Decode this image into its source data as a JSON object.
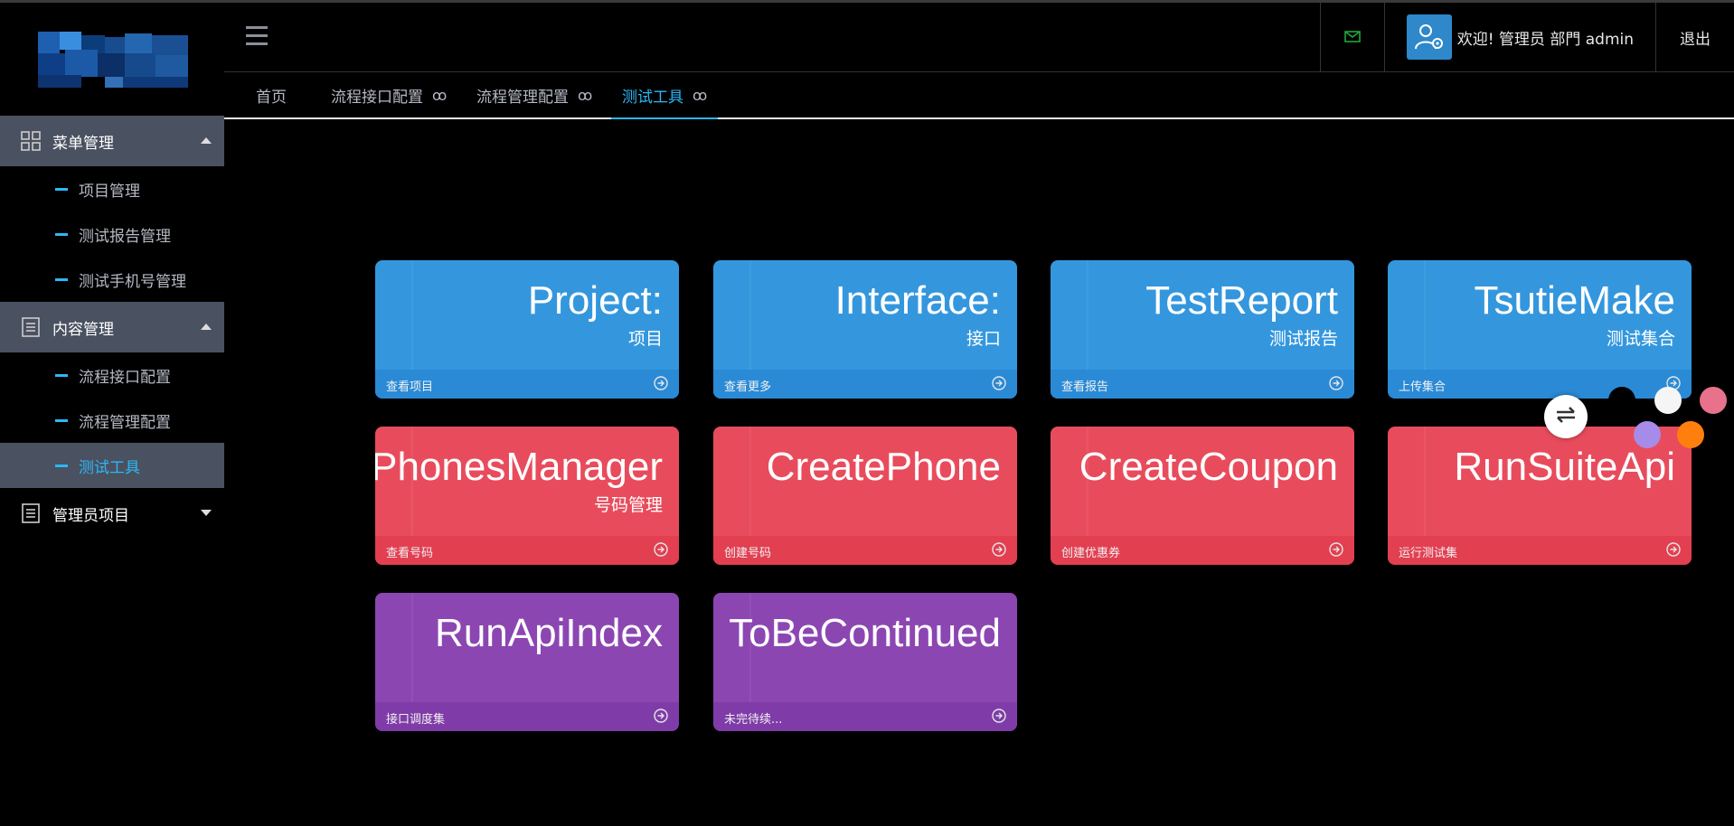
{
  "sidebar": {
    "groups": [
      {
        "label": "菜单管理",
        "items": [
          {
            "label": "项目管理"
          },
          {
            "label": "测试报告管理"
          },
          {
            "label": "测试手机号管理"
          }
        ]
      },
      {
        "label": "内容管理",
        "items": [
          {
            "label": "流程接口配置"
          },
          {
            "label": "流程管理配置"
          },
          {
            "label": "测试工具"
          }
        ]
      },
      {
        "label": "管理员项目",
        "items": []
      }
    ]
  },
  "header": {
    "welcome": "欢迎! 管理员 部門 admin",
    "logout": "退出"
  },
  "tabs": [
    {
      "label": "首页"
    },
    {
      "label": "流程接口配置",
      "close": "ꝏ"
    },
    {
      "label": "流程管理配置",
      "close": "ꝏ"
    },
    {
      "label": "测试工具",
      "close": "ꝏ"
    }
  ],
  "cards": [
    {
      "title": "Project:",
      "subtitle": "项目",
      "footer": "查看项目",
      "color": "#3497de"
    },
    {
      "title": "Interface:",
      "subtitle": "接口",
      "footer": "查看更多",
      "color": "#3497de"
    },
    {
      "title": "TestReport",
      "subtitle": "测试报告",
      "footer": "查看报告",
      "color": "#3497de"
    },
    {
      "title": "TsutieMake",
      "subtitle": "测试集合",
      "footer": "上传集合",
      "color": "#3497de"
    },
    {
      "title": "PhonesManager",
      "subtitle": "号码管理",
      "footer": "查看号码",
      "color": "#e84c5c"
    },
    {
      "title": "CreatePhone",
      "subtitle": "",
      "footer": "创建号码",
      "color": "#e84c5c"
    },
    {
      "title": "CreateCoupon",
      "subtitle": "",
      "footer": "创建优惠券",
      "color": "#e84c5c"
    },
    {
      "title": "RunSuiteApi",
      "subtitle": "",
      "footer": "运行测试集",
      "color": "#e84c5c"
    },
    {
      "title": "RunApiIndex",
      "subtitle": "",
      "footer": "接口调度集",
      "color": "#8c46b2"
    },
    {
      "title": "ToBeContinued",
      "subtitle": "",
      "footer": "未完待续...",
      "color": "#8c46b2"
    }
  ],
  "theme_swatches": [
    "#000000",
    "#f5f5f5",
    "#e8728c",
    "#a78be8",
    "#ff7f0e"
  ],
  "colors": {
    "accent": "#2db7f5",
    "sidebar_active": "#4a5160"
  }
}
